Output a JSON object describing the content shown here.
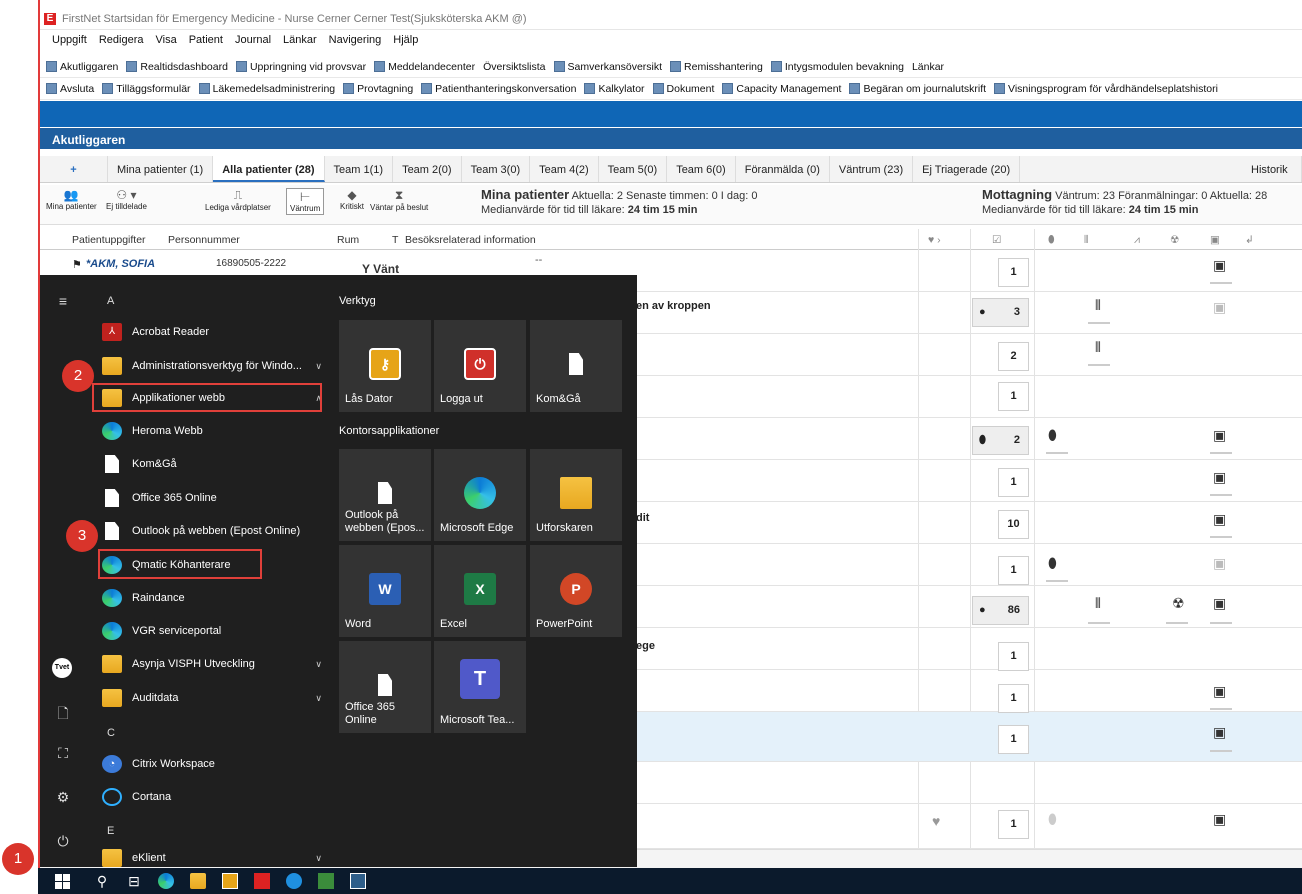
{
  "window": {
    "title": "FirstNet Startsidan för Emergency Medicine - Nurse Cerner Cerner Test(Sjuksköterska AKM @)",
    "logo_letter": "E"
  },
  "menubar": [
    "Uppgift",
    "Redigera",
    "Visa",
    "Patient",
    "Journal",
    "Länkar",
    "Navigering",
    "Hjälp"
  ],
  "toolbar1": [
    "Akutliggaren",
    "Realtidsdashboard",
    "Uppringning vid provsvar",
    "Meddelandecenter",
    "Översiktslista",
    "Samverkansöversikt",
    "Remisshantering",
    "Intygsmodulen bevakning",
    "Länkar"
  ],
  "toolbar2": [
    "Avsluta",
    "Tilläggsformulär",
    "Läkemedelsadministrering",
    "Provtagning",
    "Patienthanteringskonversation",
    "Kalkylator",
    "Dokument",
    "Capacity Management",
    "Begäran om journalutskrift",
    "Visningsprogram för vårdhändelseplatshistori"
  ],
  "section_title": "Akutliggaren",
  "tabs": [
    {
      "label": "Mina patienter (1)"
    },
    {
      "label": "Alla patienter (28)",
      "active": true
    },
    {
      "label": "Team 1(1)"
    },
    {
      "label": "Team 2(0)"
    },
    {
      "label": "Team 3(0)"
    },
    {
      "label": "Team 4(2)"
    },
    {
      "label": "Team 5(0)"
    },
    {
      "label": "Team 6(0)"
    },
    {
      "label": "Föranmälda (0)"
    },
    {
      "label": "Väntrum (23)"
    },
    {
      "label": "Ej Triagerade (20)"
    }
  ],
  "add_tab_symbol": "+",
  "history_tab": "Historik",
  "subtoolbar": {
    "buttons": [
      "Mina patienter",
      "Ej tilldelade",
      "Lediga vårdplatser",
      "Väntrum",
      "Kritiskt",
      "Väntar på beslut"
    ],
    "mina_title": "Mina patienter",
    "mina_stats": "Aktuella: 2  Senaste timmen: 0  I dag: 0",
    "mina_median": "Medianvärde för tid till läkare:",
    "mina_median_value": "24 tim 15 min",
    "mott_title": "Mottagning",
    "mott_stats": "Väntrum: 23  Föranmälningar: 0  Aktuella: 28",
    "mott_median": "Medianvärde för tid till läkare:",
    "mott_median_value": "24 tim 15 min"
  },
  "columns": {
    "patient": "Patientuppgifter",
    "pnr": "Personnummer",
    "rum": "Rum",
    "t": "T",
    "info": "Besöksrelaterad information"
  },
  "patient_row": {
    "name": "*AKM, SOFIA",
    "pnr": "16890505-2222",
    "rum": "Y Vänt",
    "info": "--"
  },
  "row_numbers": [
    "1",
    "3",
    "2",
    "1",
    "2",
    "1",
    "10",
    "1",
    "86",
    "1",
    "1",
    "1",
    "1"
  ],
  "row_texts": {
    "r2": "en av kroppen",
    "r7": "dit",
    "r11": "ege"
  },
  "start_menu": {
    "letter_a": "A",
    "letter_c": "C",
    "letter_e": "E",
    "apps": {
      "acrobat": "Acrobat Reader",
      "admin": "Administrationsverktyg för Windo...",
      "appwebb": "Applikationer webb",
      "heroma": "Heroma Webb",
      "komga": "Kom&Gå",
      "office365": "Office 365 Online",
      "outlook": "Outlook på webben (Epost Online)",
      "qmatic": "Qmatic Köhanterare",
      "raindance": "Raindance",
      "vgr": "VGR serviceportal",
      "asynja": "Asynja VISPH Utveckling",
      "auditdata": "Auditdata",
      "citrix": "Citrix Workspace",
      "cortana": "Cortana",
      "eklient": "eKlient"
    },
    "tile_groups": {
      "verktyg": "Verktyg",
      "kontor": "Kontorsapplikationer"
    },
    "tiles": {
      "lasdator": "Lås Dator",
      "loggaut": "Logga ut",
      "komga": "Kom&Gå",
      "outlook": "Outlook på webben (Epos...",
      "edge": "Microsoft Edge",
      "utforskaren": "Utforskaren",
      "word": "Word",
      "excel": "Excel",
      "powerpoint": "PowerPoint",
      "office365": "Office 365 Online",
      "teams": "Microsoft Tea..."
    },
    "tvet_label": "Tvet"
  },
  "badges": [
    "1",
    "2",
    "3"
  ],
  "colors": {
    "accent_red": "#e0403a",
    "header_blue": "#1f5f9f",
    "taskbar": "#0b1a2c",
    "startmenu": "#1f1f1f"
  }
}
